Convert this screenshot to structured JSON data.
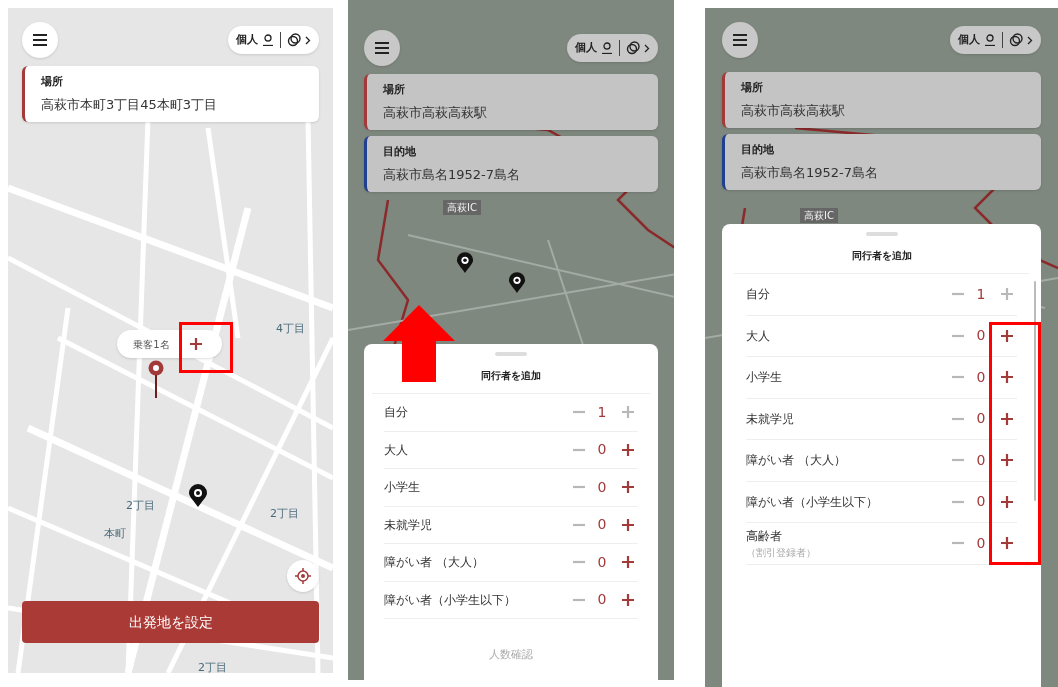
{
  "screens": [
    {
      "kind": "map",
      "mode_chip": "個人",
      "fields": [
        {
          "label": "場所",
          "value": "高萩市本町3丁目45本町3丁目",
          "color": "#a33a3a"
        }
      ],
      "passenger_chip": "乗客1名",
      "highlight_plus": true,
      "map_labels": [
        "4丁目",
        "2丁目",
        "本町",
        "2丁目",
        "2丁目"
      ],
      "action_button": "出発地を設定"
    },
    {
      "kind": "sheet",
      "mode_chip": "個人",
      "fields": [
        {
          "label": "場所",
          "value": "高萩市高萩高萩駅",
          "color": "#a33a3a"
        },
        {
          "label": "目的地",
          "value": "高萩市島名1952-7島名",
          "color": "#1f3f8f"
        }
      ],
      "map_labels": [
        "高萩IC"
      ],
      "arrow": true,
      "sheet": {
        "title": "同行者を追加",
        "rows": [
          {
            "label": "自分",
            "value": "1",
            "plus_disabled": true
          },
          {
            "label": "大人",
            "value": "0",
            "plus_disabled": false
          },
          {
            "label": "小学生",
            "value": "0",
            "plus_disabled": false
          },
          {
            "label": "未就学児",
            "value": "0",
            "plus_disabled": false
          },
          {
            "label": "障がい者 （大人）",
            "value": "0",
            "plus_disabled": false
          },
          {
            "label": "障がい者（小学生以下）",
            "value": "0",
            "plus_disabled": false
          }
        ],
        "confirm": {
          "label": "人数確認",
          "disabled": true
        }
      }
    },
    {
      "kind": "sheet",
      "mode_chip": "個人",
      "fields": [
        {
          "label": "場所",
          "value": "高萩市高萩高萩駅",
          "color": "#a33a3a"
        },
        {
          "label": "目的地",
          "value": "高萩市島名1952-7島名",
          "color": "#1f3f8f"
        }
      ],
      "map_labels": [
        "高萩IC"
      ],
      "sheet": {
        "title": "同行者を追加",
        "rows": [
          {
            "label": "自分",
            "value": "1",
            "plus_disabled": true
          },
          {
            "label": "大人",
            "value": "0",
            "plus_disabled": false
          },
          {
            "label": "小学生",
            "value": "0",
            "plus_disabled": false
          },
          {
            "label": "未就学児",
            "value": "0",
            "plus_disabled": false
          },
          {
            "label": "障がい者 （大人）",
            "value": "0",
            "plus_disabled": false
          },
          {
            "label": "障がい者（小学生以下）",
            "value": "0",
            "plus_disabled": false
          },
          {
            "label": "高齢者",
            "note": "（割引登録者）",
            "value": "0",
            "plus_disabled": false
          }
        ],
        "highlight_plus": true
      }
    }
  ]
}
